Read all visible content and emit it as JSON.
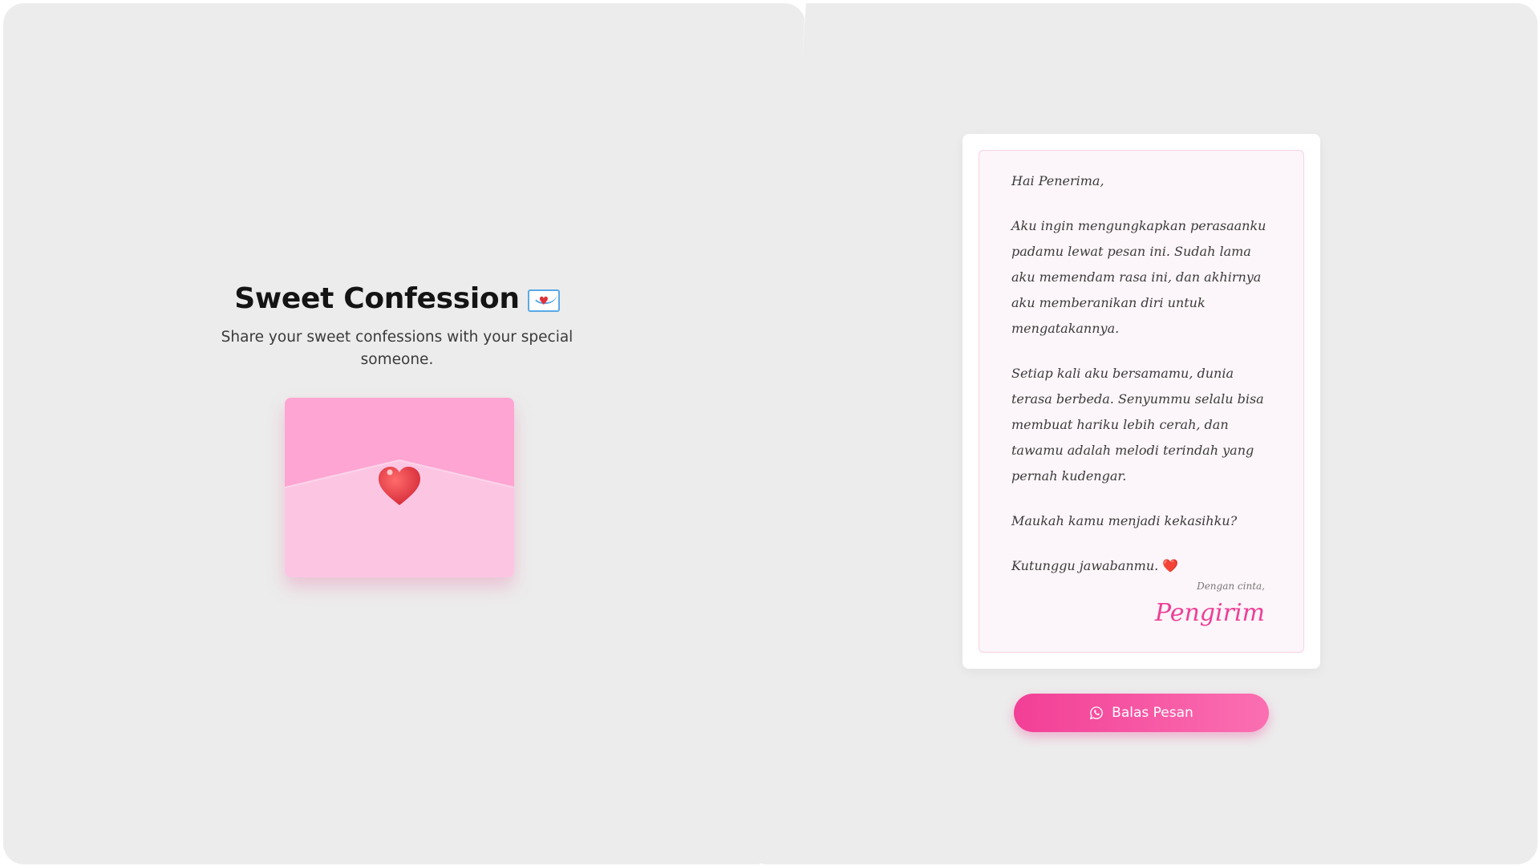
{
  "hero": {
    "title": "Sweet Confession",
    "title_emoji": "love-letter-icon",
    "subtitle": "Share your sweet confessions with your special someone."
  },
  "envelope": {
    "icon": "heart-seal-icon",
    "colors": {
      "flap": "#fea5d3",
      "body": "#fcc6e3",
      "heart": "#e83a44"
    }
  },
  "letter": {
    "greeting": "Hai Penerima,",
    "paragraphs": [
      "Aku ingin mengungkapkan perasaanku padamu lewat pesan ini. Sudah lama aku memendam rasa ini, dan akhirnya aku memberanikan diri untuk mengatakannya.",
      "Setiap kali aku bersamamu, dunia terasa berbeda. Senyummu selalu bisa membuat hariku lebih cerah, dan tawamu adalah melodi terindah yang pernah kudengar.",
      "Maukah kamu menjadi kekasihku?"
    ],
    "closing": "Kutunggu jawabanmu.",
    "closing_emoji": "❤️",
    "signoff_label": "Dengan cinta,",
    "sender": "Pengirim"
  },
  "reply": {
    "label": "Balas Pesan",
    "icon": "whatsapp-icon",
    "gradient": [
      "#f23f96",
      "#fb6fb2"
    ]
  },
  "theme": {
    "panel_bg": "#ececec",
    "accent": "#ee3f97"
  }
}
